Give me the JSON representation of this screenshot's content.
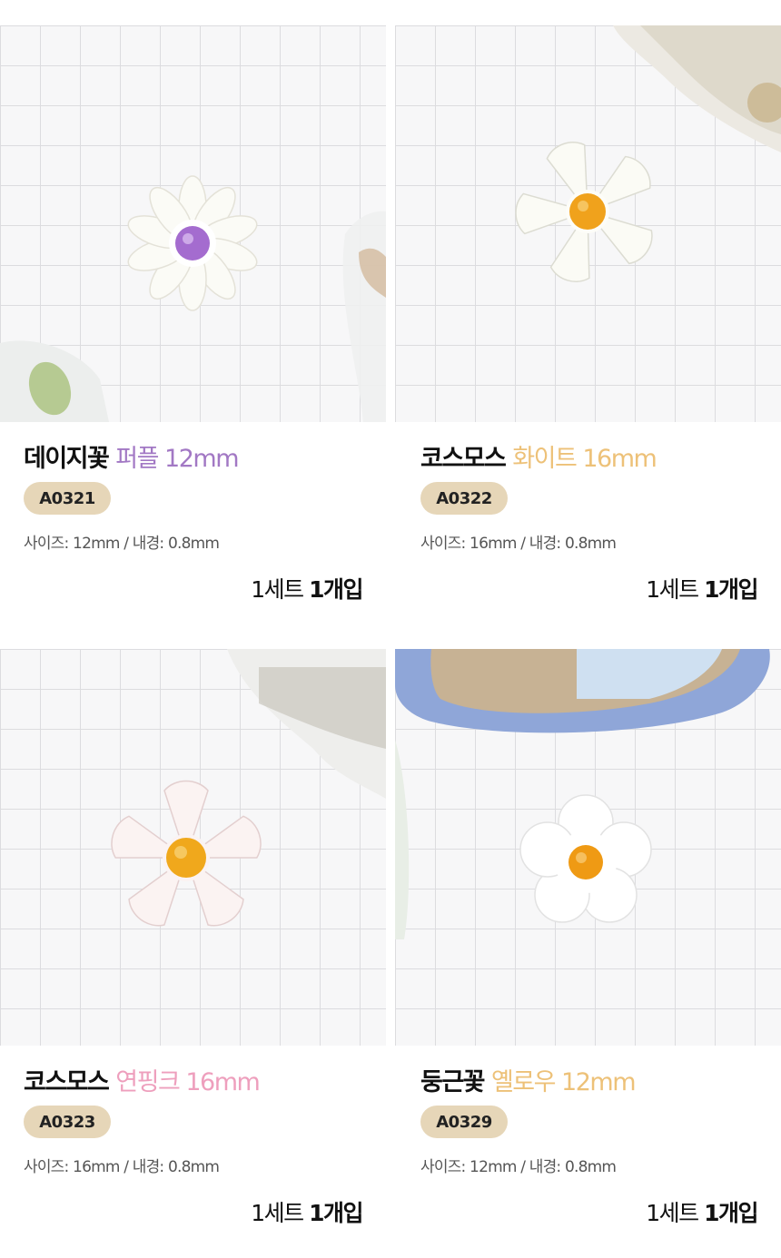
{
  "products": [
    {
      "name": "데이지꽃",
      "variant": "퍼플 12mm",
      "variant_color": "#a278c4",
      "code": "A0321",
      "spec": "사이즈: 12mm / 내경: 0.8mm",
      "qty_unit": "1세트",
      "qty_count": "1개입",
      "image_icon": "daisy-purple-bead"
    },
    {
      "name": "코스모스",
      "variant": "화이트 16mm",
      "variant_color": "#edc178",
      "code": "A0322",
      "spec": "사이즈: 16mm / 내경: 0.8mm",
      "qty_unit": "1세트",
      "qty_count": "1개입",
      "image_icon": "cosmos-white-bead"
    },
    {
      "name": "코스모스",
      "variant": "연핑크 16mm",
      "variant_color": "#ee9fbd",
      "code": "A0323",
      "spec": "사이즈: 16mm / 내경: 0.8mm",
      "qty_unit": "1세트",
      "qty_count": "1개입",
      "image_icon": "cosmos-pink-bead"
    },
    {
      "name": "둥근꽃",
      "variant": "옐로우 12mm",
      "variant_color": "#edc178",
      "code": "A0329",
      "spec": "사이즈: 12mm / 내경: 0.8mm",
      "qty_unit": "1세트",
      "qty_count": "1개입",
      "image_icon": "round-flower-yellow-bead"
    }
  ],
  "badge_color": "#e6d6b8"
}
